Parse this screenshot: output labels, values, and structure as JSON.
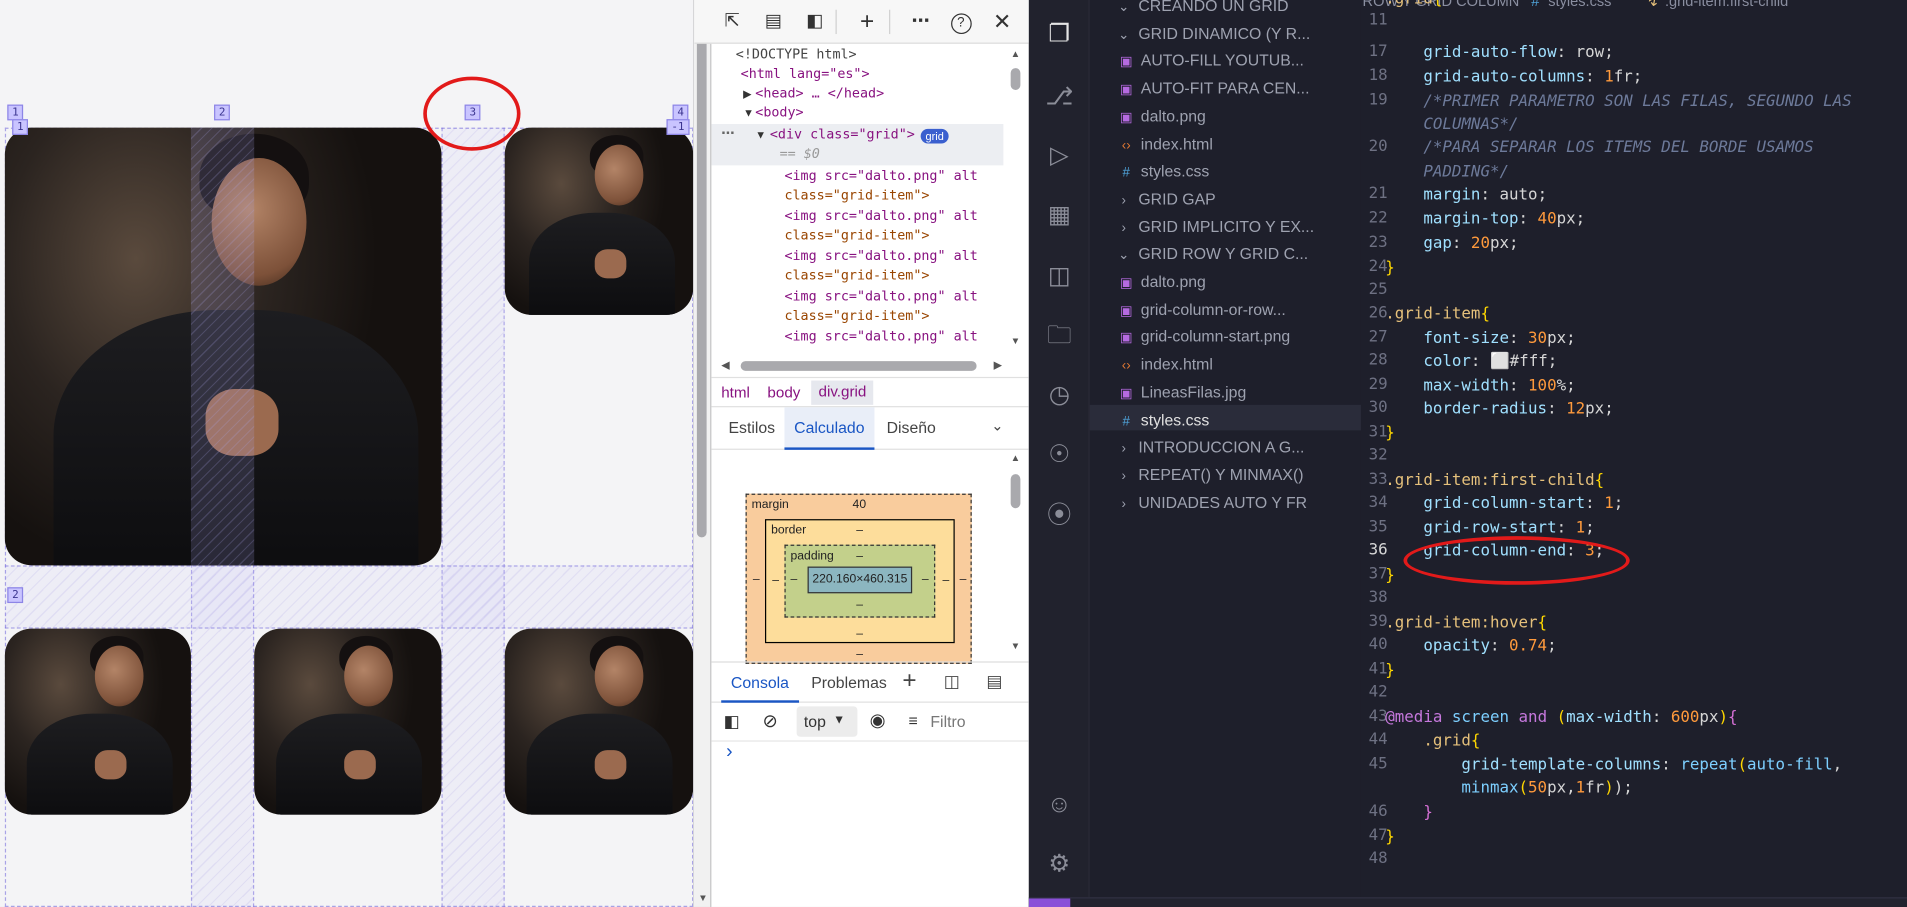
{
  "grid_overlay": {
    "top_labels": [
      "1",
      "2",
      "3",
      "4"
    ],
    "top_inner_labels": [
      "1",
      "-1"
    ],
    "row_label": "2"
  },
  "devtools": {
    "toolbar_icons": [
      "inspect-icon",
      "device-icon",
      "dock-icon",
      "plus-icon",
      "more-icon",
      "help-icon",
      "close-icon"
    ],
    "dom_lines": [
      "<!DOCTYPE html>",
      "<html lang=\"es\">",
      "<head> … </head>",
      "<body>",
      "<div class=\"grid\">",
      "== $0",
      "<img src=\"dalto.png\" alt",
      "class=\"grid-item\">",
      "<img src=\"dalto.png\" alt",
      "class=\"grid-item\">",
      "<img src=\"dalto.png\" alt",
      "class=\"grid-item\">",
      "<img src=\"dalto.png\" alt",
      "class=\"grid-item\">",
      "<img src=\"dalto.png\" alt"
    ],
    "grid_badge": "grid",
    "breadcrumbs": [
      "html",
      "body",
      "div.grid"
    ],
    "tabs": [
      "Estilos",
      "Calculado",
      "Diseño"
    ],
    "active_tab": "Calculado",
    "box_model": {
      "margin_label": "margin",
      "margin_value": "40",
      "border_label": "border",
      "border_value": "–",
      "padding_label": "padding",
      "padding_value": "–",
      "content": "220.160×460.315",
      "dash": "–"
    },
    "console_tabs": [
      "Consola",
      "Problemas"
    ],
    "console_context": "top",
    "filter_placeholder": "Filtro",
    "prompt": "›"
  },
  "vscode": {
    "breadcrumb": {
      "folder": "GRID ROW Y GRID COLUMN",
      "file": "styles.css",
      "symbol": ".grid-item:first-child"
    },
    "explorer": [
      {
        "type": "folder-open",
        "label": "CREANDO UN GRID"
      },
      {
        "type": "folder-open",
        "label": "GRID DINAMICO (Y R..."
      },
      {
        "type": "image",
        "label": "AUTO-FILL YOUTUB..."
      },
      {
        "type": "image",
        "label": "AUTO-FIT PARA CEN..."
      },
      {
        "type": "image",
        "label": "dalto.png"
      },
      {
        "type": "html",
        "label": "index.html"
      },
      {
        "type": "css",
        "label": "styles.css"
      },
      {
        "type": "folder",
        "label": "GRID GAP"
      },
      {
        "type": "folder",
        "label": "GRID IMPLICITO Y EX..."
      },
      {
        "type": "folder-open",
        "label": "GRID ROW Y GRID C..."
      },
      {
        "type": "image",
        "label": "dalto.png"
      },
      {
        "type": "image",
        "label": "grid-column-or-row..."
      },
      {
        "type": "image",
        "label": "grid-column-start.png"
      },
      {
        "type": "html",
        "label": "index.html"
      },
      {
        "type": "image",
        "label": "LineasFilas.jpg"
      },
      {
        "type": "css",
        "label": "styles.css"
      },
      {
        "type": "folder",
        "label": "INTRODUCCION A G..."
      },
      {
        "type": "folder",
        "label": "REPEAT() Y MINMAX()"
      },
      {
        "type": "folder",
        "label": "UNIDADES AUTO Y FR"
      }
    ],
    "line_numbers": [
      "11",
      "17",
      "18",
      "19",
      "",
      "20",
      "",
      "21",
      "22",
      "23",
      "24",
      "25",
      "26",
      "27",
      "28",
      "29",
      "30",
      "31",
      "32",
      "33",
      "34",
      "35",
      "36",
      "37",
      "38",
      "39",
      "40",
      "41",
      "42",
      "43",
      "44",
      "45",
      "",
      "46",
      "47",
      "48"
    ],
    "current_line": "36"
  }
}
